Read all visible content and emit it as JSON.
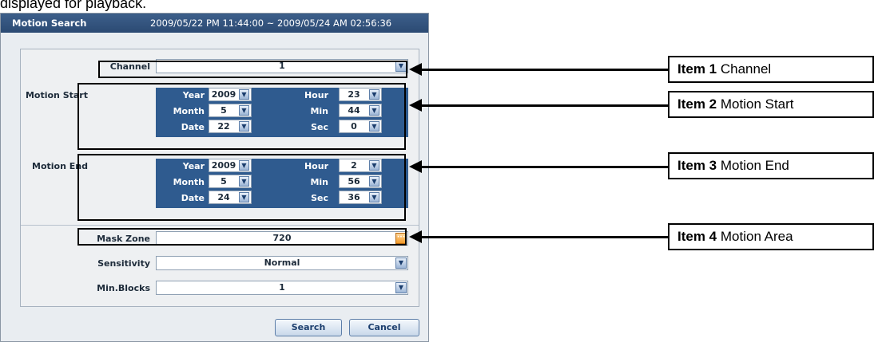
{
  "caption": "displayed for playback.",
  "dialog": {
    "title": "Motion Search",
    "range": "2009/05/22 PM 11:44:00 ~ 2009/05/24 AM 02:56:36",
    "channel": {
      "label": "Channel",
      "value": "1"
    },
    "motion_start": {
      "label": "Motion Start",
      "year_label": "Year",
      "year": "2009",
      "month_label": "Month",
      "month": "5",
      "date_label": "Date",
      "date": "22",
      "hour_label": "Hour",
      "hour": "23",
      "min_label": "Min",
      "min": "44",
      "sec_label": "Sec",
      "sec": "0"
    },
    "motion_end": {
      "label": "Motion End",
      "year_label": "Year",
      "year": "2009",
      "month_label": "Month",
      "month": "5",
      "date_label": "Date",
      "date": "24",
      "hour_label": "Hour",
      "hour": "2",
      "min_label": "Min",
      "min": "56",
      "sec_label": "Sec",
      "sec": "36"
    },
    "mask_zone": {
      "label": "Mask Zone",
      "value": "720"
    },
    "sensitivity": {
      "label": "Sensitivity",
      "value": "Normal"
    },
    "min_blocks": {
      "label": "Min.Blocks",
      "value": "1"
    },
    "search_label": "Search",
    "cancel_label": "Cancel"
  },
  "callouts": [
    {
      "bold": "Item 1",
      "text": "Channel"
    },
    {
      "bold": "Item 2",
      "text": "Motion Start"
    },
    {
      "bold": "Item 3",
      "text": "Motion End"
    },
    {
      "bold": "Item 4",
      "text": "Motion Area"
    }
  ],
  "icons": {
    "dropdown": "chevron-down-icon",
    "more": "ellipsis-icon"
  },
  "colors": {
    "title_bar": "#2b4a73",
    "grid_bg": "#2f5b8f",
    "more_button": "#f29b2b"
  }
}
